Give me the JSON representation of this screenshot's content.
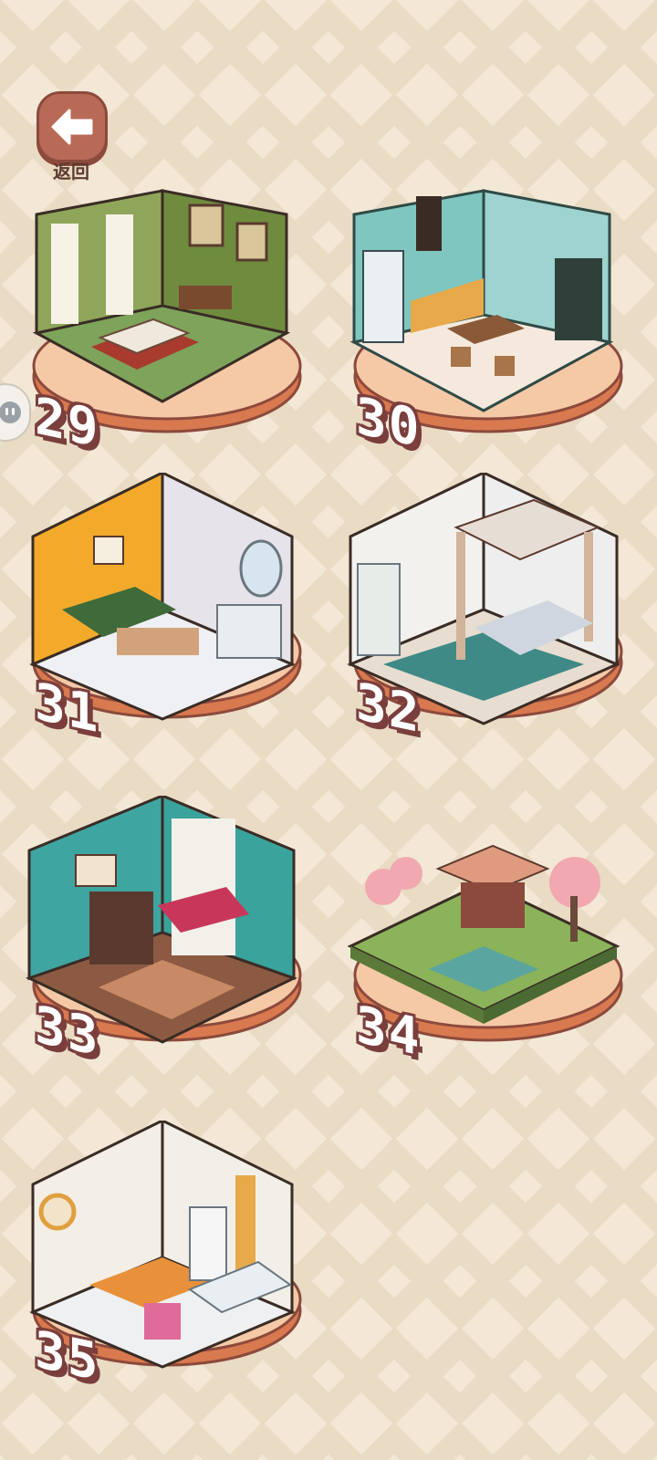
{
  "header": {
    "back_label": "返回"
  },
  "colors": {
    "background": "#f3e8d6",
    "pattern": "#e9dbc4",
    "pedestal": "#f5c9a6",
    "pedestal_rim": "#d9794f",
    "accent": "#b86a57",
    "number_outline": "#7a3f3d"
  },
  "levels": [
    {
      "number": "29",
      "theme": "green dining room"
    },
    {
      "number": "30",
      "theme": "teal kitchen"
    },
    {
      "number": "31",
      "theme": "yellow bedroom"
    },
    {
      "number": "32",
      "theme": "canopy bedroom"
    },
    {
      "number": "33",
      "theme": "teal living room"
    },
    {
      "number": "34",
      "theme": "pagoda garden"
    },
    {
      "number": "35",
      "theme": "bathroom"
    }
  ]
}
